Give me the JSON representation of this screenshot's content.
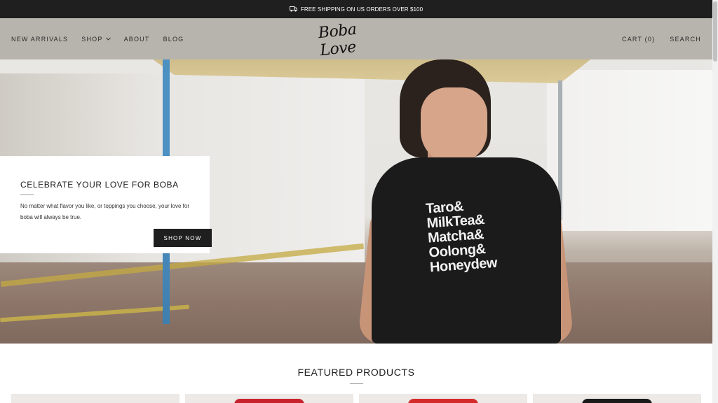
{
  "announcement": {
    "text": "FREE SHIPPING ON US ORDERS OVER $100",
    "icon": "truck-icon"
  },
  "header": {
    "nav_left": [
      {
        "label": "NEW ARRIVALS"
      },
      {
        "label": "SHOP",
        "has_dropdown": true
      },
      {
        "label": "ABOUT"
      },
      {
        "label": "BLOG"
      }
    ],
    "logo": "Boba Love",
    "cart_label": "CART (0)",
    "search_label": "SEARCH"
  },
  "hero": {
    "title": "CELEBRATE YOUR LOVE FOR BOBA",
    "body": "No matter what flavor you like, or toppings you choose, your love for boba will always be true.",
    "button": "SHOP NOW",
    "shirt_lines": [
      "Taro&",
      "MilkTea&",
      "Matcha&",
      "Oolong&",
      "Honeydew"
    ]
  },
  "featured": {
    "title": "FEATURED PRODUCTS",
    "products": [
      {
        "shirt_color": ""
      },
      {
        "shirt_color": "#c8232c"
      },
      {
        "shirt_color": "#d42a2a"
      },
      {
        "shirt_color": "#1a1a1a"
      }
    ]
  },
  "colors": {
    "announcement_bg": "#1f1f1f",
    "header_bg": "#b7b4ad",
    "button_bg": "#1f1f1f"
  }
}
